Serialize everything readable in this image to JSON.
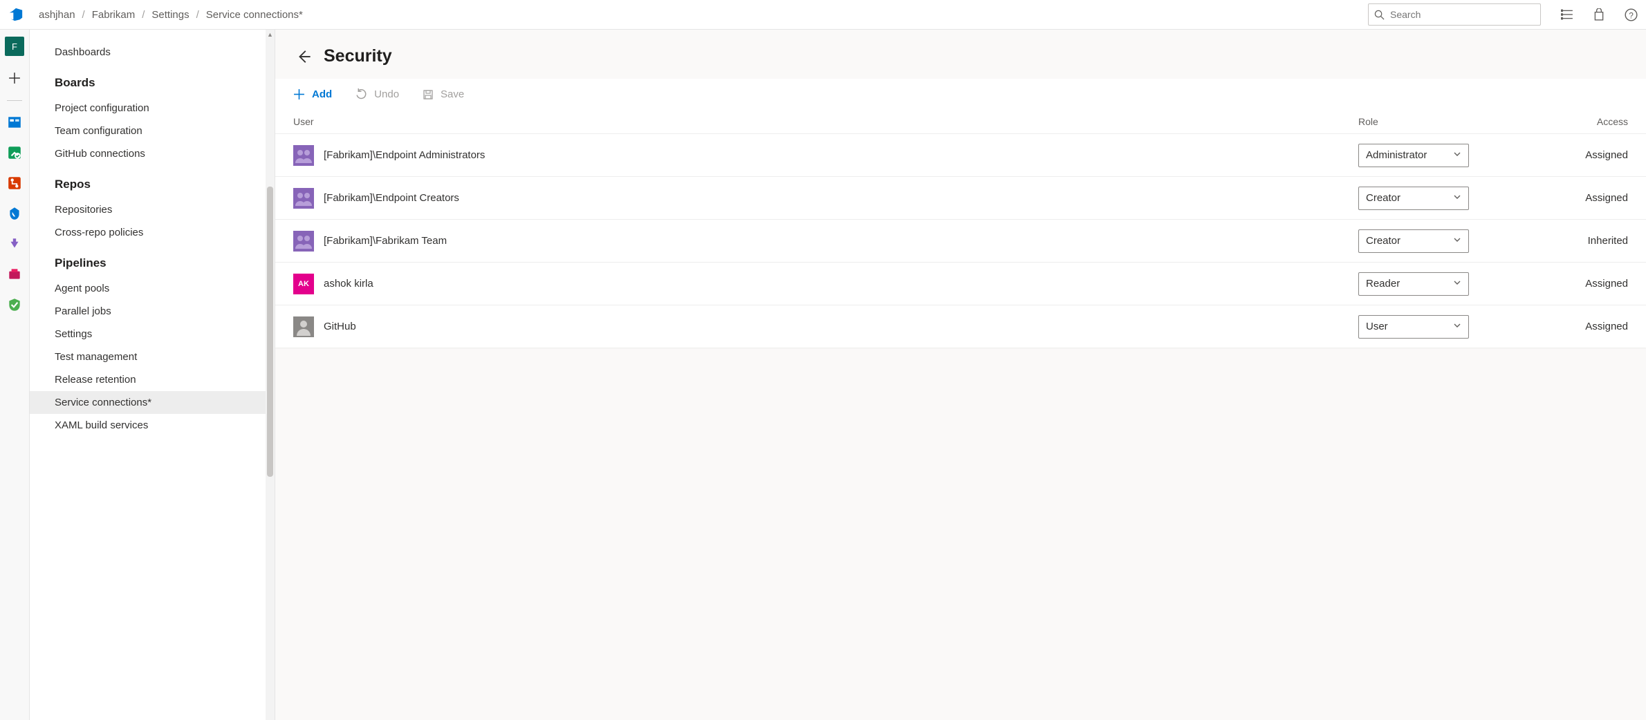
{
  "breadcrumb": {
    "items": [
      "ashjhan",
      "Fabrikam",
      "Settings",
      "Service connections*"
    ]
  },
  "search": {
    "placeholder": "Search"
  },
  "rail": {
    "project_initial": "F"
  },
  "sidebar": {
    "dashboards": "Dashboards",
    "sections": [
      {
        "title": "Boards",
        "items": [
          "Project configuration",
          "Team configuration",
          "GitHub connections"
        ]
      },
      {
        "title": "Repos",
        "items": [
          "Repositories",
          "Cross-repo policies"
        ]
      },
      {
        "title": "Pipelines",
        "items": [
          "Agent pools",
          "Parallel jobs",
          "Settings",
          "Test management",
          "Release retention",
          "Service connections*",
          "XAML build services"
        ]
      }
    ],
    "selected": "Service connections*"
  },
  "page": {
    "title": "Security"
  },
  "toolbar": {
    "add": "Add",
    "undo": "Undo",
    "save": "Save"
  },
  "table": {
    "headers": {
      "user": "User",
      "role": "Role",
      "access": "Access"
    },
    "rows": [
      {
        "name": "[Fabrikam]\\Endpoint Administrators",
        "avatar": "group",
        "role": "Administrator",
        "access": "Assigned"
      },
      {
        "name": "[Fabrikam]\\Endpoint Creators",
        "avatar": "group",
        "role": "Creator",
        "access": "Assigned"
      },
      {
        "name": "[Fabrikam]\\Fabrikam Team",
        "avatar": "group",
        "role": "Creator",
        "access": "Inherited"
      },
      {
        "name": "ashok kirla",
        "avatar": "user",
        "initials": "AK",
        "role": "Reader",
        "access": "Assigned"
      },
      {
        "name": "GitHub",
        "avatar": "gh",
        "role": "User",
        "access": "Assigned"
      }
    ]
  }
}
